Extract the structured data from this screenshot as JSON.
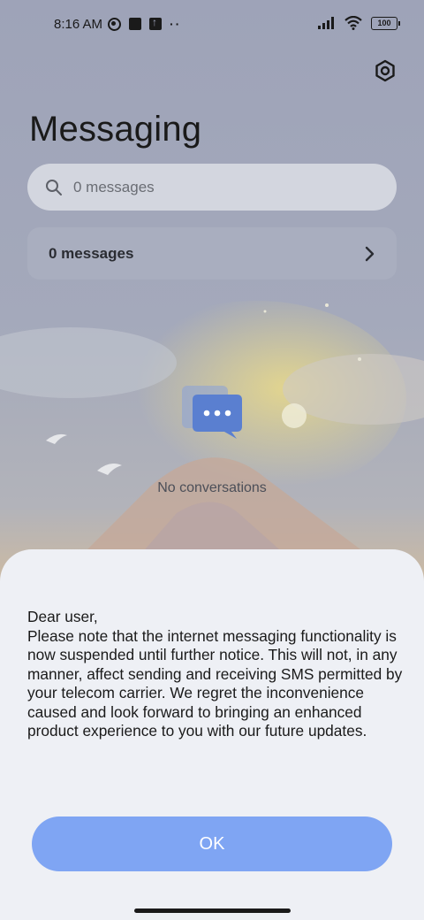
{
  "status_bar": {
    "time": "8:16 AM",
    "battery": "100",
    "left_icons": [
      "vpn-icon",
      "square-notification-icon",
      "upload-icon",
      "more-dots-icon"
    ],
    "right_icons": [
      "signal-icon",
      "wifi-icon",
      "battery-icon"
    ],
    "dots": "··"
  },
  "header": {
    "title": "Messaging",
    "settings_icon": "settings-hexagon-icon"
  },
  "search": {
    "placeholder": "0 messages",
    "icon": "search-icon"
  },
  "messages_row": {
    "label": "0 messages",
    "icon": "chevron-right-icon"
  },
  "empty_state": {
    "text": "No conversations",
    "icon": "chat-bubble-icon"
  },
  "dialog": {
    "lines": [
      "Dear user,",
      "Please note that the internet messaging functionality is now suspended until further notice. This will not, in any manner, affect sending and receiving SMS permitted by your telecom carrier. We regret the inconvenience caused and look forward to bringing an enhanced product experience to you with our future updates."
    ],
    "ok_label": "OK"
  },
  "colors": {
    "accent": "#7fa5f3",
    "chat_icon": "#5a7fd0",
    "sheet_bg": "#eef0f5"
  }
}
